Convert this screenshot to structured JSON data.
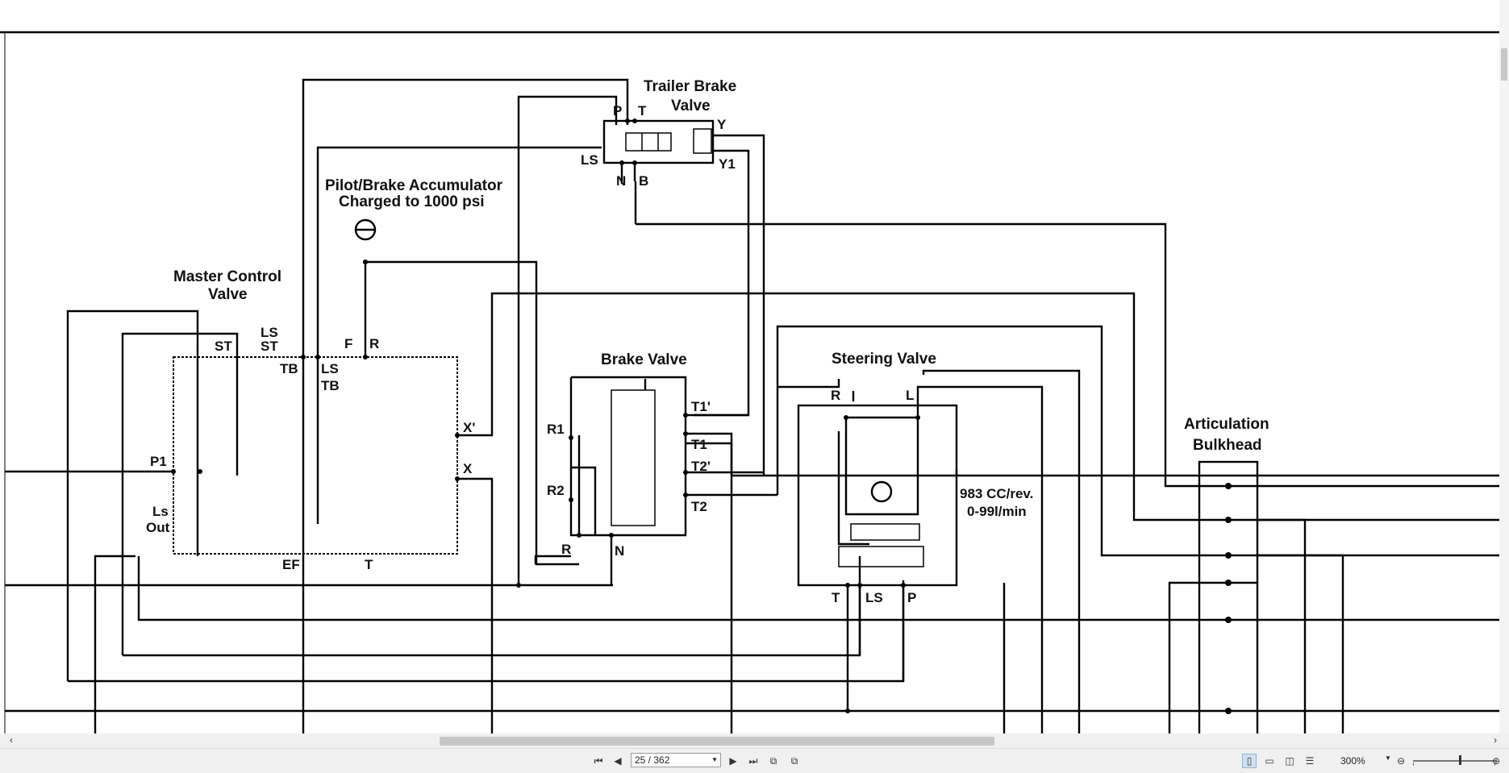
{
  "document": {
    "labels": {
      "trailer_brake_1": "Trailer Brake",
      "trailer_brake_2": "Valve",
      "accumulator_1": "Pilot/Brake Accumulator",
      "accumulator_2": "Charged to 1000 psi",
      "master_1": "Master Control",
      "master_2": "Valve",
      "brake_valve": "Brake Valve",
      "steering_valve": "Steering Valve",
      "artic_1": "Articulation",
      "artic_2": "Bulkhead",
      "pump_1": "983 CC/rev.",
      "pump_2": "0-99l/min"
    },
    "ports": {
      "P": "P",
      "T": "T",
      "Y": "Y",
      "LS": "LS",
      "N": "N",
      "B": "B",
      "Y1": "Y1",
      "ST": "ST",
      "LS1": "LS",
      "ST2": "ST",
      "TB": "TB",
      "LS2": "LS",
      "TB2": "TB",
      "F": "F",
      "R": "R",
      "X1": "X'",
      "X": "X",
      "P1": "P1",
      "Ls": "Ls",
      "Out": "Out",
      "EF": "EF",
      "Tm": "T",
      "R1": "R1",
      "R2": "R2",
      "Rb": "R",
      "Nb": "N",
      "T1p": "T1'",
      "T1": "T1",
      "T2p": "T2'",
      "T2": "T2",
      "Rs": "R",
      "Ls_s": "L",
      "Ts": "T",
      "LSs": "LS",
      "Ps": "P"
    }
  },
  "statusbar": {
    "page_value": "25 / 362",
    "zoom": "300%"
  },
  "icons": {
    "first": "first-page-icon",
    "prev": "prev-page-icon",
    "next": "next-page-icon",
    "last": "last-page-icon"
  }
}
